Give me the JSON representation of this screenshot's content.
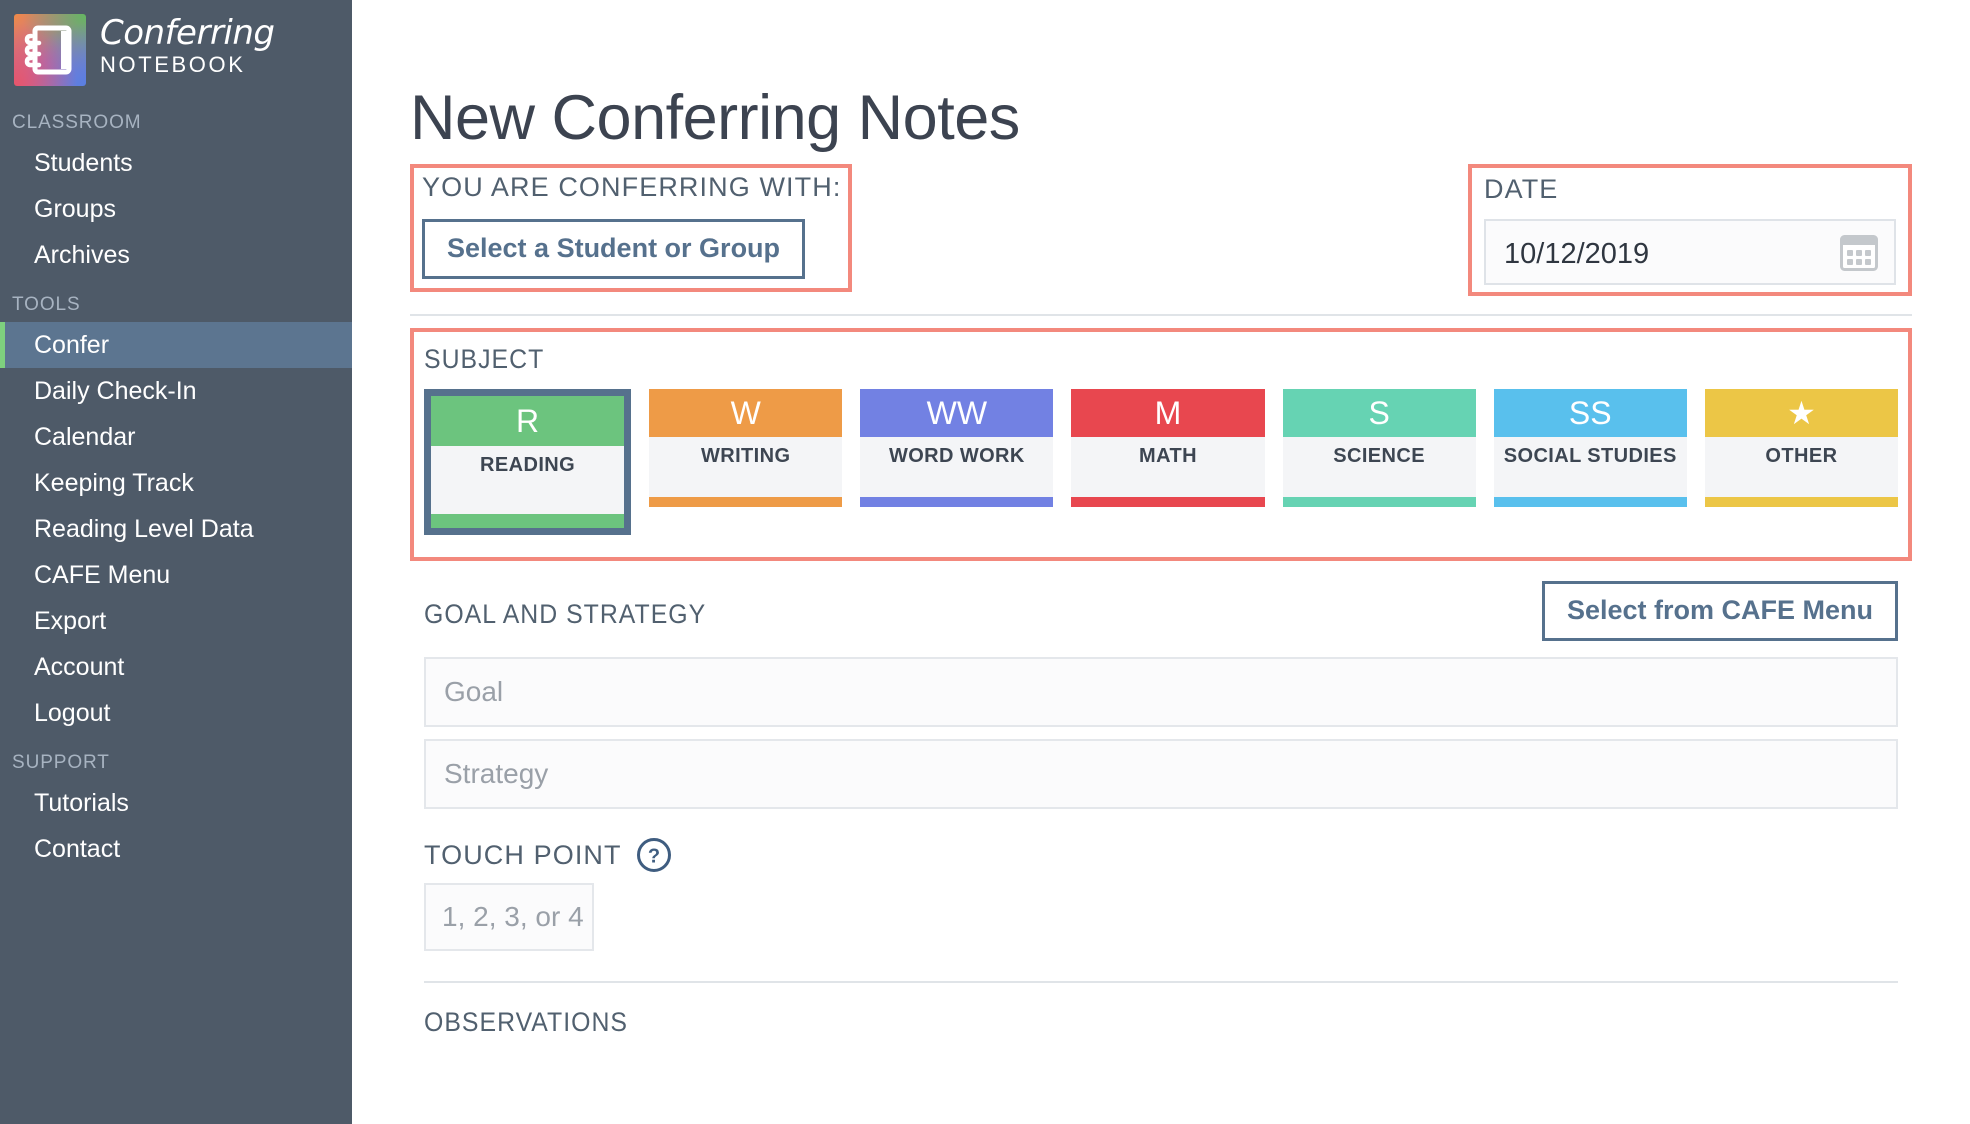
{
  "brand": {
    "title": "Conferring",
    "subtitle": "NOTEBOOK",
    "logo_icon": "notebook-icon"
  },
  "sidebar": {
    "sections": [
      {
        "label": "CLASSROOM",
        "items": [
          {
            "label": "Students",
            "active": false
          },
          {
            "label": "Groups",
            "active": false
          },
          {
            "label": "Archives",
            "active": false
          }
        ]
      },
      {
        "label": "TOOLS",
        "items": [
          {
            "label": "Confer",
            "active": true
          },
          {
            "label": "Daily Check-In",
            "active": false
          },
          {
            "label": "Calendar",
            "active": false
          },
          {
            "label": "Keeping Track",
            "active": false
          },
          {
            "label": "Reading Level Data",
            "active": false
          },
          {
            "label": "CAFE Menu",
            "active": false
          },
          {
            "label": "Export",
            "active": false
          },
          {
            "label": "Account",
            "active": false
          },
          {
            "label": "Logout",
            "active": false
          }
        ]
      },
      {
        "label": "SUPPORT",
        "items": [
          {
            "label": "Tutorials",
            "active": false
          },
          {
            "label": "Contact",
            "active": false
          }
        ]
      }
    ]
  },
  "page": {
    "title": "New Conferring Notes"
  },
  "confer_with": {
    "label": "YOU ARE CONFERRING WITH:",
    "button_label": "Select a Student or Group"
  },
  "date": {
    "label": "DATE",
    "value": "10/12/2019",
    "icon": "calendar-icon"
  },
  "subject": {
    "label": "SUBJECT",
    "tiles": [
      {
        "abbr": "R",
        "name": "READING",
        "color": "#6cc47e",
        "selected": true,
        "icon": ""
      },
      {
        "abbr": "W",
        "name": "WRITING",
        "color": "#ee9b47",
        "selected": false,
        "icon": ""
      },
      {
        "abbr": "WW",
        "name": "WORD WORK",
        "color": "#7281e3",
        "selected": false,
        "icon": ""
      },
      {
        "abbr": "M",
        "name": "MATH",
        "color": "#e8474f",
        "selected": false,
        "icon": ""
      },
      {
        "abbr": "S",
        "name": "SCIENCE",
        "color": "#66d3b3",
        "selected": false,
        "icon": ""
      },
      {
        "abbr": "SS",
        "name": "SOCIAL STUDIES",
        "color": "#59c0ed",
        "selected": false,
        "icon": ""
      },
      {
        "abbr": "★",
        "name": "OTHER",
        "color": "#ecc646",
        "selected": false,
        "icon": "star-icon"
      }
    ]
  },
  "goal_strategy": {
    "label": "GOAL AND STRATEGY",
    "cafe_button_label": "Select from CAFE Menu",
    "goal_placeholder": "Goal",
    "strategy_placeholder": "Strategy"
  },
  "touch_point": {
    "label": "TOUCH POINT",
    "help_icon": "question-mark-icon",
    "placeholder": "1, 2, 3, or 4"
  },
  "observations": {
    "label": "OBSERVATIONS"
  },
  "colors": {
    "sidebar_bg": "#4e5a68",
    "sidebar_active_bg": "#5c7590",
    "sidebar_active_accent": "#7ed07e",
    "accent_outline": "#56718d",
    "callout_highlight": "#f3897d",
    "text_dark": "#3c4350",
    "label_grey": "#51606f",
    "placeholder_grey": "#9aa0a8"
  }
}
